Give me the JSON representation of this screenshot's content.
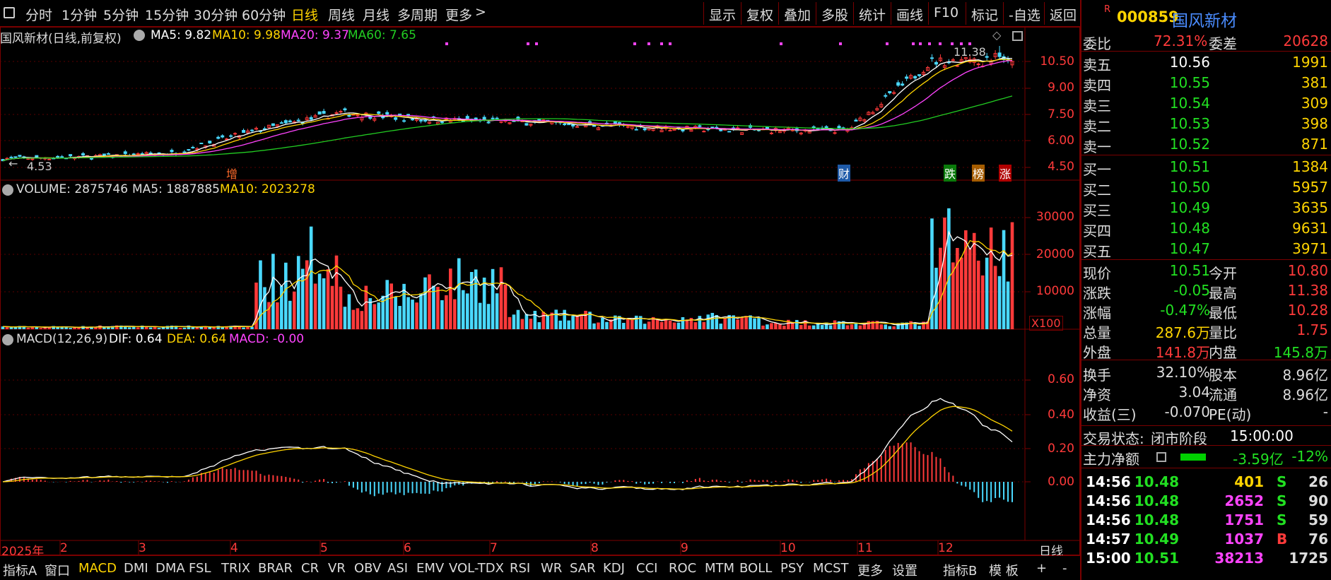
{
  "toolbar": {
    "left_items": [
      "分时",
      "1分钟",
      "5分钟",
      "15分钟",
      "30分钟",
      "60分钟",
      "日线",
      "周线",
      "月线",
      "多周期",
      "更多"
    ],
    "active_item": "日线",
    "right_items": [
      "显示",
      "复权",
      "叠加",
      "多股",
      "统计",
      "画线",
      "F10",
      "标记",
      "-自选",
      "返回"
    ]
  },
  "kline": {
    "title": "国风新材(日线,前复权)",
    "ma5_label": "MA5: 9.82",
    "ma10_label": "MA10: 9.98",
    "ma20_label": "MA20: 9.37",
    "ma60_label": "MA60: 7.65",
    "high_note": "11.38",
    "low_note": "4.53",
    "y_ticks": [
      "10.50",
      "9.00",
      "7.50",
      "6.00",
      "4.50"
    ],
    "markers": [
      "增",
      "财",
      "跌",
      "榜",
      "涨"
    ]
  },
  "volume": {
    "label": "VOLUME: 2875746",
    "ma5_label": "MA5: 1887885",
    "ma10_label": "MA10: 2023278",
    "y_ticks": [
      "30000",
      "20000",
      "10000"
    ],
    "unit": "X100"
  },
  "macd": {
    "label": "MACD(12,26,9)",
    "dif_label": "DIF: 0.64",
    "dea_label": "DEA: 0.64",
    "macd_label": "MACD: -0.00",
    "y_ticks": [
      "0.60",
      "0.40",
      "0.20",
      "0.00"
    ]
  },
  "x_axis": {
    "labels": [
      "2025年",
      "2",
      "3",
      "4",
      "5",
      "6",
      "7",
      "8",
      "9",
      "10",
      "11",
      "12"
    ],
    "period": "日线"
  },
  "bottom": {
    "items": [
      "指标A",
      "窗口",
      "MACD",
      "DMI",
      "DMA",
      "FSL",
      "TRIX",
      "BRAR",
      "CR",
      "VR",
      "OBV",
      "ASI",
      "EMV",
      "VOL-TDX",
      "RSI",
      "WR",
      "SAR",
      "KDJ",
      "CCI",
      "ROC",
      "MTM",
      "BOLL",
      "PSY",
      "MCST",
      "更多",
      "设置"
    ],
    "active": "MACD",
    "right_items": [
      "指标B",
      "模 板",
      "+",
      "-"
    ]
  },
  "stock": {
    "badge": "R",
    "code": "000859",
    "name": "国风新材"
  },
  "order_book": {
    "weibi_label": "委比",
    "weibi": "72.31%",
    "weicha_label": "委差",
    "weicha": "20628",
    "asks": [
      {
        "label": "卖五",
        "price": "10.56",
        "vol": "1991"
      },
      {
        "label": "卖四",
        "price": "10.55",
        "vol": "381"
      },
      {
        "label": "卖三",
        "price": "10.54",
        "vol": "309"
      },
      {
        "label": "卖二",
        "price": "10.53",
        "vol": "398"
      },
      {
        "label": "卖一",
        "price": "10.52",
        "vol": "871"
      }
    ],
    "bids": [
      {
        "label": "买一",
        "price": "10.51",
        "vol": "1384"
      },
      {
        "label": "买二",
        "price": "10.50",
        "vol": "5957"
      },
      {
        "label": "买三",
        "price": "10.49",
        "vol": "3635"
      },
      {
        "label": "买四",
        "price": "10.48",
        "vol": "9631"
      },
      {
        "label": "买五",
        "price": "10.47",
        "vol": "3971"
      }
    ]
  },
  "quote": {
    "rows": [
      {
        "l1": "现价",
        "v1": "10.51",
        "l2": "今开",
        "v2": "10.80"
      },
      {
        "l1": "涨跌",
        "v1": "-0.05",
        "l2": "最高",
        "v2": "11.38"
      },
      {
        "l1": "涨幅",
        "v1": "-0.47%",
        "l2": "最低",
        "v2": "10.28"
      },
      {
        "l1": "总量",
        "v1": "287.6万",
        "l2": "量比",
        "v2": "1.75"
      },
      {
        "l1": "外盘",
        "v1": "141.8万",
        "l2": "内盘",
        "v2": "145.8万"
      }
    ]
  },
  "fundamentals": {
    "rows": [
      {
        "l1": "换手",
        "v1": "32.10%",
        "l2": "股本",
        "v2": "8.96亿"
      },
      {
        "l1": "净资",
        "v1": "3.04",
        "l2": "流通",
        "v2": "8.96亿"
      },
      {
        "l1": "收益(三)",
        "v1": "-0.070",
        "l2": "PE(动)",
        "v2": "-"
      }
    ]
  },
  "status": {
    "label": "交易状态:",
    "value": "闭市阶段",
    "time": "15:00:00"
  },
  "flow": {
    "label": "主力净额",
    "value": "-3.59亿",
    "pct": "-12%"
  },
  "ticks": [
    {
      "time": "14:56",
      "price": "10.48",
      "vol": "401",
      "side": "S",
      "n": "26"
    },
    {
      "time": "14:56",
      "price": "10.48",
      "vol": "2652",
      "side": "S",
      "n": "90"
    },
    {
      "time": "14:56",
      "price": "10.48",
      "vol": "1751",
      "side": "S",
      "n": "59"
    },
    {
      "time": "14:57",
      "price": "10.49",
      "vol": "1037",
      "side": "B",
      "n": "76"
    },
    {
      "time": "15:00",
      "price": "10.51",
      "vol": "38213",
      "side": "",
      "n": "1725"
    }
  ],
  "colors": {
    "up": "#ff3a3a",
    "down": "#4ad9ff",
    "ma5": "#ffffff",
    "ma10": "#ffd400",
    "ma20": "#ff44ff",
    "ma60": "#22cc22",
    "frame": "#7a0000"
  },
  "chart_data": [
    {
      "type": "candlestick",
      "title": "国风新材(日线,前复权)",
      "x_range": [
        "2025-01",
        "2025-12"
      ],
      "y_ticks": [
        4.5,
        6.0,
        7.5,
        9.0,
        10.5
      ],
      "ylim": [
        4.0,
        11.8
      ],
      "monthly_close": [
        5.0,
        5.1,
        5.3,
        6.6,
        7.6,
        7.2,
        7.1,
        6.9,
        6.7,
        6.6,
        6.6,
        10.51
      ],
      "series": [
        {
          "name": "MA5",
          "last": 9.82
        },
        {
          "name": "MA10",
          "last": 9.98
        },
        {
          "name": "MA20",
          "last": 9.37
        },
        {
          "name": "MA60",
          "last": 7.65
        }
      ],
      "annotations": [
        {
          "text": "11.38",
          "kind": "high"
        },
        {
          "text": "4.53",
          "kind": "low"
        }
      ]
    },
    {
      "type": "bar",
      "title": "VOLUME",
      "y_ticks": [
        10000,
        20000,
        30000
      ],
      "ylim": [
        0,
        35000
      ],
      "unit": "X100",
      "monthly_avg": [
        600,
        700,
        650,
        14000,
        9000,
        13000,
        3500,
        2500,
        3000,
        1800,
        1500,
        22000
      ],
      "last": 28757
    },
    {
      "type": "line",
      "title": "MACD(12,26,9)",
      "y_ticks": [
        0.0,
        0.2,
        0.4,
        0.6
      ],
      "ylim": [
        -0.12,
        0.78
      ],
      "series": [
        {
          "name": "DIF",
          "last": 0.64
        },
        {
          "name": "DEA",
          "last": 0.64
        },
        {
          "name": "MACD",
          "last": -0.0
        }
      ]
    }
  ]
}
